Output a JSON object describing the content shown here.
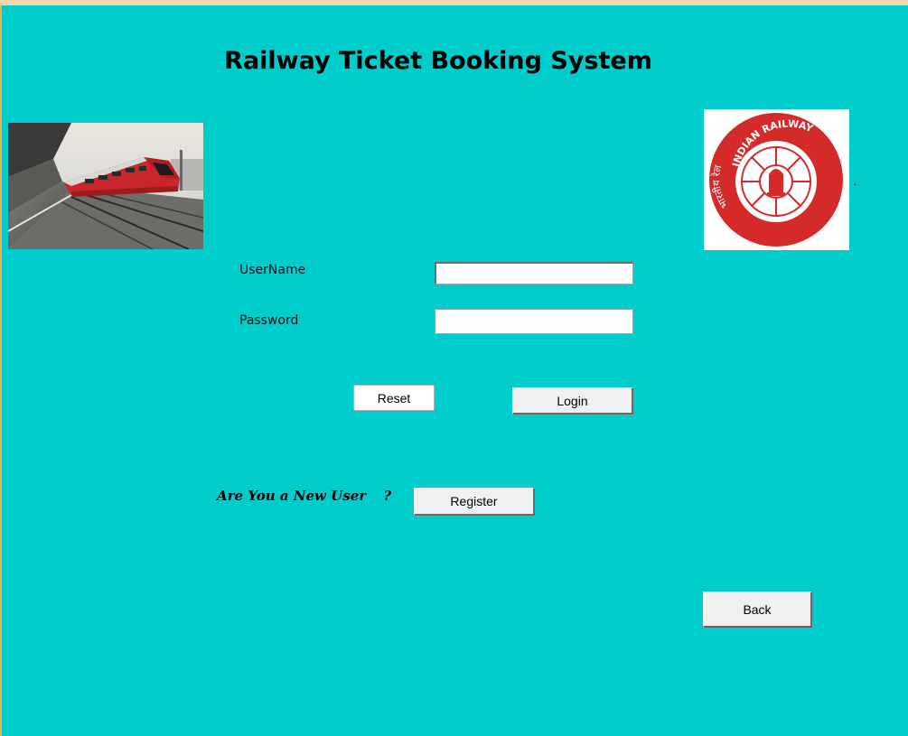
{
  "app": {
    "title": "Railway Ticket Booking System"
  },
  "images": {
    "train_photo": "train-photo",
    "logo_text": "INDIAN RAILWAY",
    "logo_text_hindi": "भारतीय रेल"
  },
  "form": {
    "username_label": "UserName",
    "username_value": "",
    "password_label": "Password",
    "password_value": ""
  },
  "buttons": {
    "reset": "Reset",
    "login": "Login",
    "register": "Register",
    "back": "Back"
  },
  "register_prompt": {
    "text": "Are You a New User",
    "question_mark": "?"
  },
  "misc": {
    "stray_dot": "."
  },
  "colors": {
    "background": "#00cccc",
    "logo_red": "#d42a2a"
  }
}
